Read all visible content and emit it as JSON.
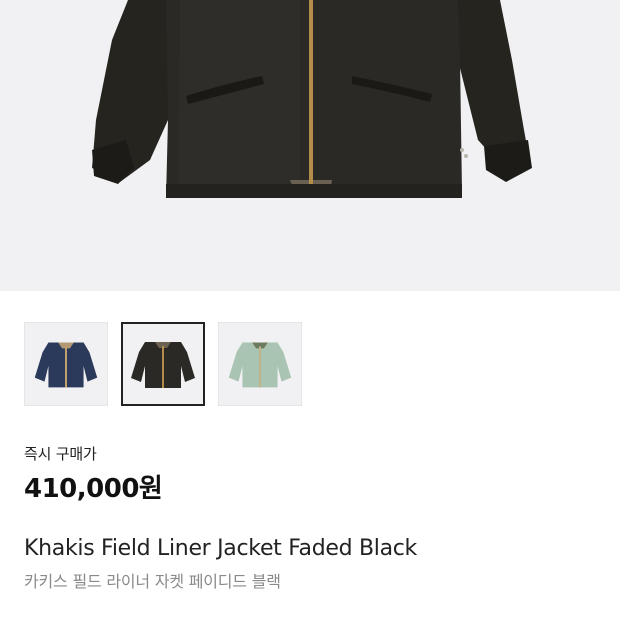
{
  "product": {
    "image_alt": "jacket",
    "price_label": "즉시 구매가",
    "price": "410,000원",
    "title": "Khakis Field Liner Jacket Faded Black",
    "subtitle": "카키스 필드 라이너 자켓 페이디드 블랙"
  },
  "thumbnails": [
    {
      "color_name": "navy",
      "color": "#2b3a5a",
      "selected": false
    },
    {
      "color_name": "faded-black",
      "color": "#2a2925",
      "selected": true
    },
    {
      "color_name": "mint",
      "color": "#a9c4b2",
      "selected": false
    }
  ],
  "colors": {
    "hero_bg": "#f1f1f3",
    "selected_border": "#222222",
    "subtitle": "#8a8a8a"
  }
}
